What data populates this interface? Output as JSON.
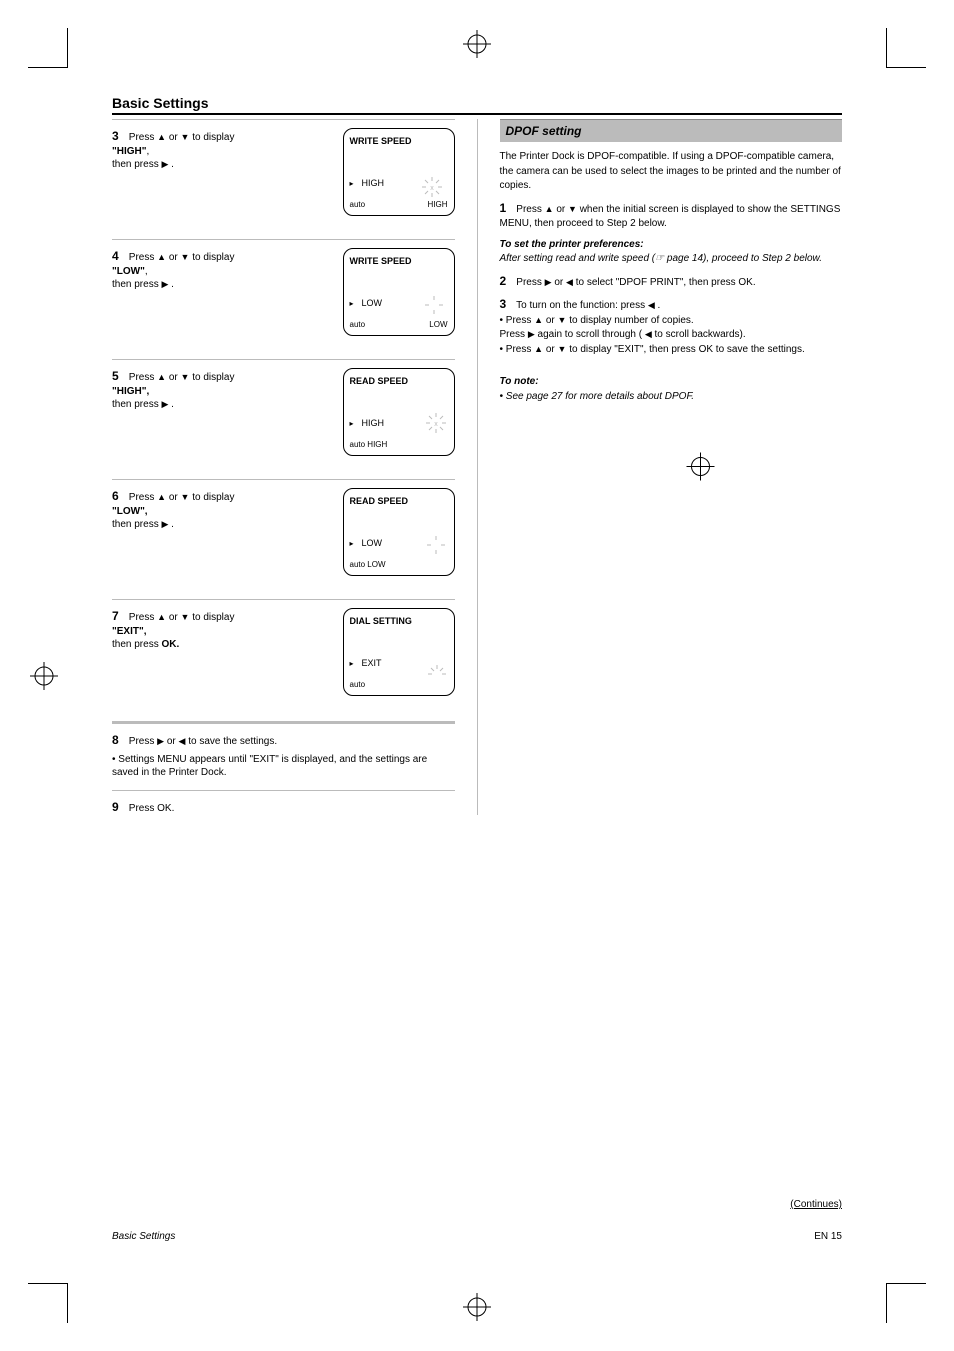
{
  "page": {
    "heading": "Basic Settings",
    "footer_left": "Basic Settings",
    "footer_right": "EN 15",
    "continued": "(Continues)"
  },
  "left": {
    "steps": [
      {
        "num": "3",
        "text_a": "Press  ",
        "text_b": "  or  ",
        "text_c": "  to display",
        "option": "\"HIGH\"",
        "press": "then press  ",
        "press_after": " .",
        "lcd": {
          "line1": "WRITE SPEED",
          "mid": "HIGH",
          "bl": "auto",
          "br": "HIGH",
          "icon": "big"
        }
      },
      {
        "num": "4",
        "text_a": "Press  ",
        "text_b": "  or  ",
        "text_c": "  to display",
        "option": "\"LOW\"",
        "press": "then press  ",
        "press_after": " .",
        "lcd": {
          "line1": "WRITE SPEED",
          "mid": "LOW",
          "bl": "auto",
          "br": "LOW",
          "icon": "small"
        }
      },
      {
        "num": "5",
        "text_a": "Press  ",
        "text_b": "  or  ",
        "text_c": "  to display",
        "option": "\"HIGH\",",
        "press": "then press  ",
        "press_after": " .",
        "lcd": {
          "line1": "READ SPEED",
          "mid": "HIGH",
          "bl": "auto   HIGH",
          "br": "",
          "icon": "big-right"
        }
      },
      {
        "num": "6",
        "text_a": "Press  ",
        "text_b": "  or  ",
        "text_c": "  to display",
        "option": "\"LOW\",",
        "press": "then press  ",
        "press_after": " .",
        "lcd": {
          "line1": "READ SPEED",
          "mid": "LOW",
          "bl": "auto   LOW",
          "br": "",
          "icon": "small-right"
        }
      },
      {
        "num": "7",
        "text_a": "Press  ",
        "text_b": "  or  ",
        "text_c": "  to display",
        "option": "\"EXIT\",",
        "press": "then press",
        "press_after": " OK.",
        "lcd": {
          "line1": "DIAL SETTING",
          "mid": "EXIT",
          "bl": "auto",
          "br": "",
          "icon": "corner"
        }
      }
    ],
    "step8": {
      "num": "8",
      "line1a": "Press  ",
      "line1b": "  or  ",
      "line1c": "  to save the settings.",
      "bullet": "• Settings MENU appears until \"EXIT\" is displayed, and the settings are saved in the Printer Dock."
    },
    "step9": {
      "num": "9",
      "line1": "Press OK."
    }
  },
  "right": {
    "section_title": "DPOF setting",
    "intro": "The Printer Dock is DPOF-compatible. If using a DPOF-compatible camera, the camera can be used to select the images to be printed and the number of copies.",
    "step1": {
      "num": "1",
      "text_a": "Press  ",
      "text_b": "  or  ",
      "text_c": " when the initial screen is displayed to show the SETTINGS MENU, then proceed to Step 2 below.",
      "note_lead": "To set the printer preferences:",
      "note_body": "After setting read and write speed (☞ page 14), proceed to Step 2 below."
    },
    "step2": {
      "num": "2",
      "text_a": "Press  ",
      "text_b": "  or  ",
      "text_c": "  to select \"DPOF PRINT\", then press OK."
    },
    "step3": {
      "num": "3",
      "line1": "To turn on the function: press  ",
      "line1_end": " .",
      "bullet1": "• Press  ",
      "bullet1_mid": "  or  ",
      "bullet1_end": "  to display number of copies.",
      "line2": "Press  ",
      "line2_end": "  again to scroll through (  ",
      "line2_tail": "  to scroll backwards).",
      "bullet2": "• Press  ",
      "bullet2_mid": "  or  ",
      "bullet2_end": "  to display \"EXIT\", then press OK to save the settings."
    },
    "tonote": {
      "label": "To note:",
      "body": "• See page 27 for more details about DPOF."
    }
  }
}
